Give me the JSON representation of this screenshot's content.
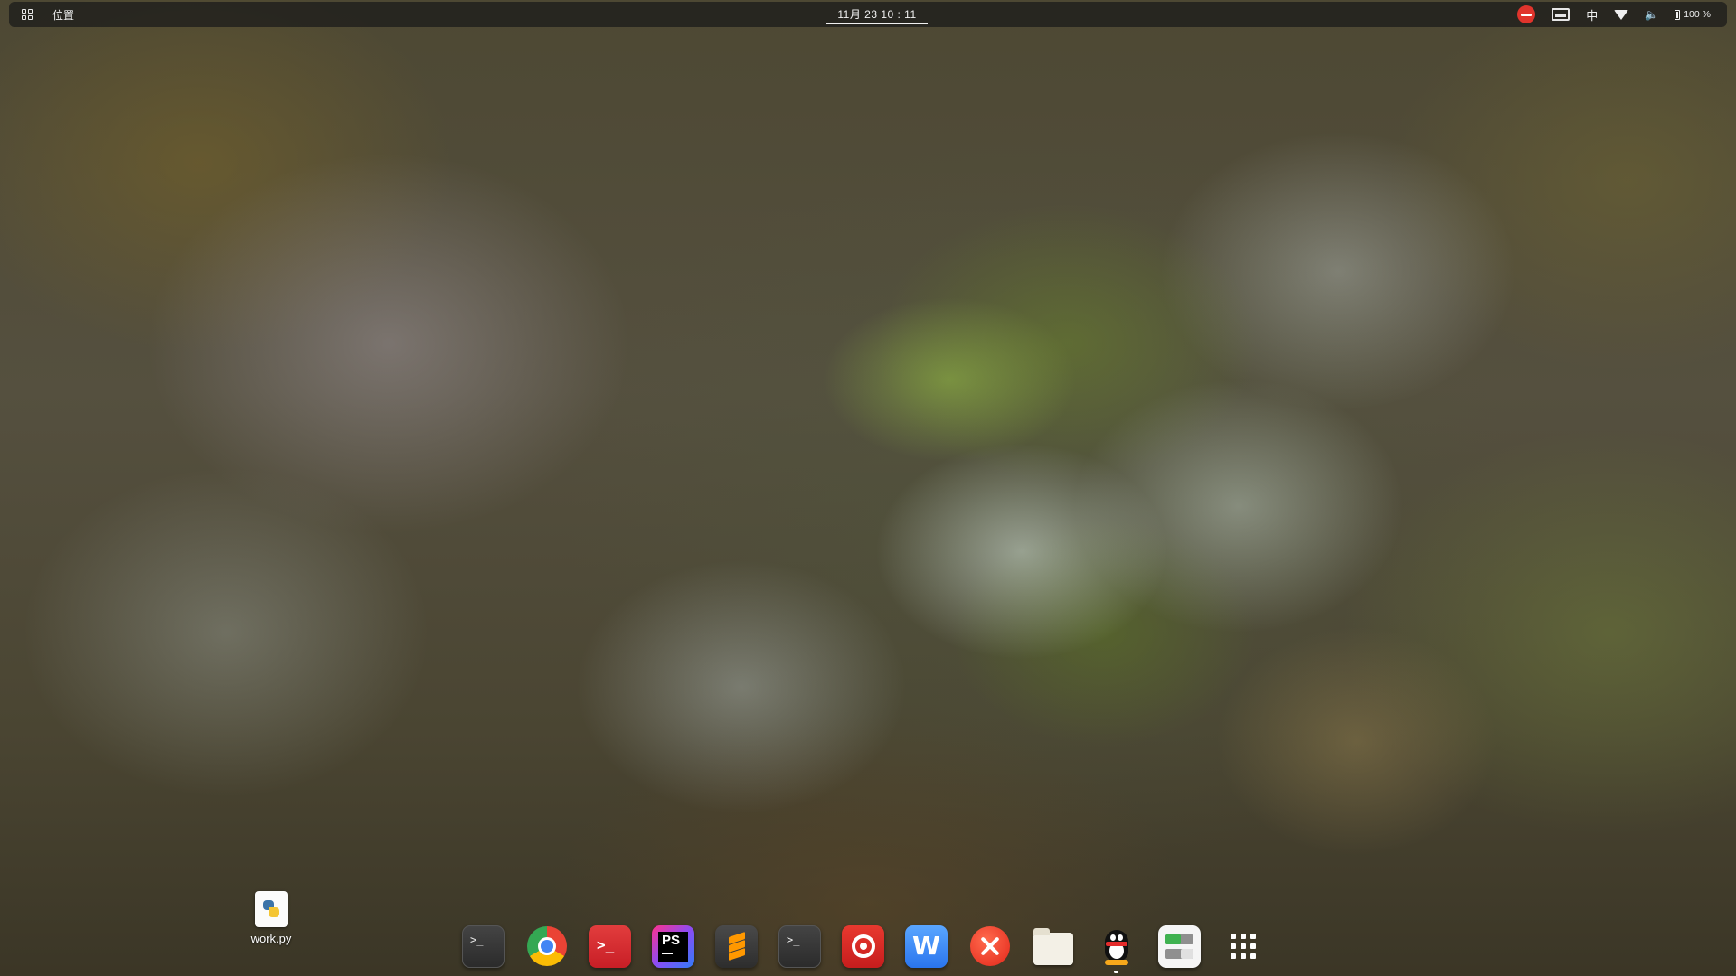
{
  "topbar": {
    "activities_icon": "app-grid-icon",
    "places_label": "位置",
    "clock": "11月 23  10 : 11",
    "tray": {
      "dnd_icon": "do-not-disturb-icon",
      "screen_icon": "screenshot-icon",
      "input_method": "中",
      "wifi_icon": "wifi-icon",
      "volume_icon": "volume-muted-icon",
      "battery_icon": "battery-icon",
      "battery_percent": "100 %"
    }
  },
  "desktop": {
    "files": [
      {
        "name": "work.py",
        "icon": "python-file-icon"
      }
    ]
  },
  "dock": {
    "apps": [
      {
        "id": "terminal",
        "icon": "terminal-icon",
        "running": false
      },
      {
        "id": "chrome",
        "icon": "chrome-icon",
        "running": false
      },
      {
        "id": "red-terminal",
        "icon": "red-terminal-icon",
        "running": false
      },
      {
        "id": "phpstorm",
        "icon": "phpstorm-icon",
        "label": "PS",
        "running": false
      },
      {
        "id": "sublime-text",
        "icon": "sublime-text-icon",
        "running": false
      },
      {
        "id": "terminal-2",
        "icon": "terminal-icon",
        "running": false
      },
      {
        "id": "netease-music",
        "icon": "netease-music-icon",
        "running": false
      },
      {
        "id": "wps-writer",
        "icon": "wps-writer-icon",
        "label": "W",
        "running": false
      },
      {
        "id": "xmind",
        "icon": "xmind-icon",
        "running": false
      },
      {
        "id": "files",
        "icon": "folder-icon",
        "running": false
      },
      {
        "id": "qq",
        "icon": "qq-penguin-icon",
        "running": true
      },
      {
        "id": "system-monitor",
        "icon": "system-monitor-icon",
        "running": false
      },
      {
        "id": "show-applications",
        "icon": "app-grid-icon",
        "running": false
      }
    ]
  },
  "colors": {
    "accent_red": "#e0342c",
    "topbar_bg": "#191919"
  }
}
